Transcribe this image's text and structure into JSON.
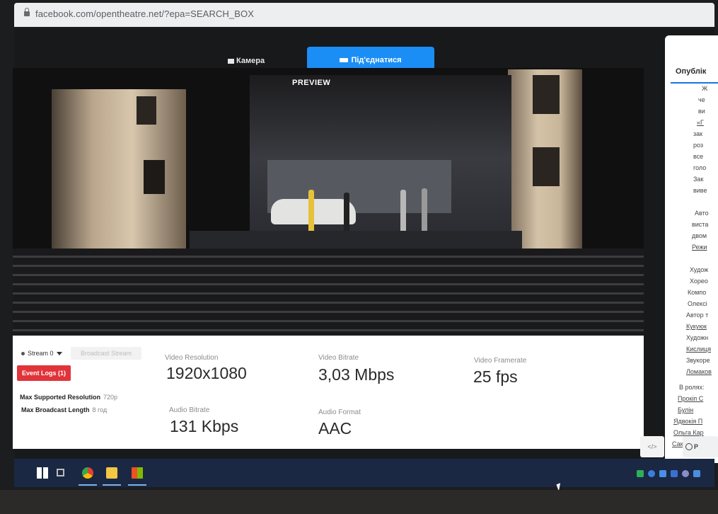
{
  "browser": {
    "url": "facebook.com/opentheatre.net/?epa=SEARCH_BOX"
  },
  "controls": {
    "camera_label": "Камера",
    "connect_label": "Під'єднатися",
    "preview_label": "PREVIEW"
  },
  "stream_panel": {
    "stream_select": "Stream 0",
    "broadcast_button": "Broadcast Stream",
    "event_logs": "Event Logs (1)",
    "max_resolution_label": "Max Supported Resolution",
    "max_resolution_value": "720p",
    "max_length_label": "Max Broadcast Length",
    "max_length_value": "8 год"
  },
  "metrics": {
    "video_resolution_label": "Video Resolution",
    "video_resolution_value": "1920x1080",
    "video_bitrate_label": "Video Bitrate",
    "video_bitrate_value": "3,03 Mbps",
    "video_framerate_label": "Video Framerate",
    "video_framerate_value": "25 fps",
    "audio_bitrate_label": "Audio Bitrate",
    "audio_bitrate_value": "131 Kbps",
    "audio_format_label": "Audio Format",
    "audio_format_value": "AAC"
  },
  "sidebar": {
    "title": "Опублік",
    "lines": [
      "Ж",
      "че",
      "ви",
      "«Г",
      "зак",
      "роз",
      "все",
      "голо",
      "Зак",
      "виве",
      "Авто",
      "виста",
      "двом",
      "Режи",
      "Худож",
      "Хорео",
      "Компо",
      "Олексі",
      "Автор т",
      "Кукуюк",
      "Художн",
      "Кислиця",
      "Звукоре",
      "Ломаков",
      "В ролях:",
      "Прокіп С",
      "Булін",
      "Ядвокія П",
      "Ольга Кар",
      "Саккита П"
    ],
    "code_button": "</>",
    "bottom_button": "P"
  }
}
